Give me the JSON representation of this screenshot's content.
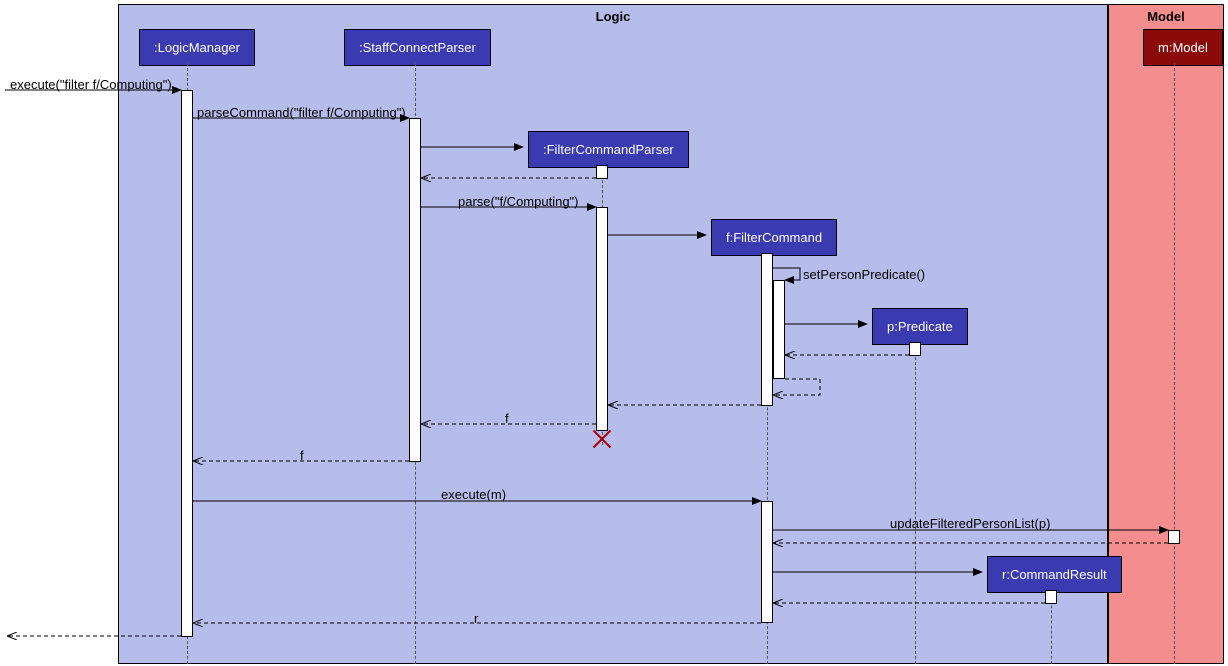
{
  "frames": {
    "logic": "Logic",
    "model": "Model"
  },
  "participants": {
    "logicManager": ":LogicManager",
    "staffConnectParser": ":StaffConnectParser",
    "filterCommandParser": ":FilterCommandParser",
    "filterCommand": "f:FilterCommand",
    "predicate": "p:Predicate",
    "commandResult": "r:CommandResult",
    "model": "m:Model"
  },
  "messages": {
    "execute": "execute(\"filter f/Computing\")",
    "parseCommand": "parseCommand(\"filter f/Computing\")",
    "parse": "parse(\"f/Computing\")",
    "setPersonPredicate": "setPersonPredicate()",
    "returnF1": "f",
    "returnF2": "f",
    "executeM": "execute(m)",
    "updateFilteredPersonList": "updateFilteredPersonList(p)",
    "returnR": "r"
  }
}
